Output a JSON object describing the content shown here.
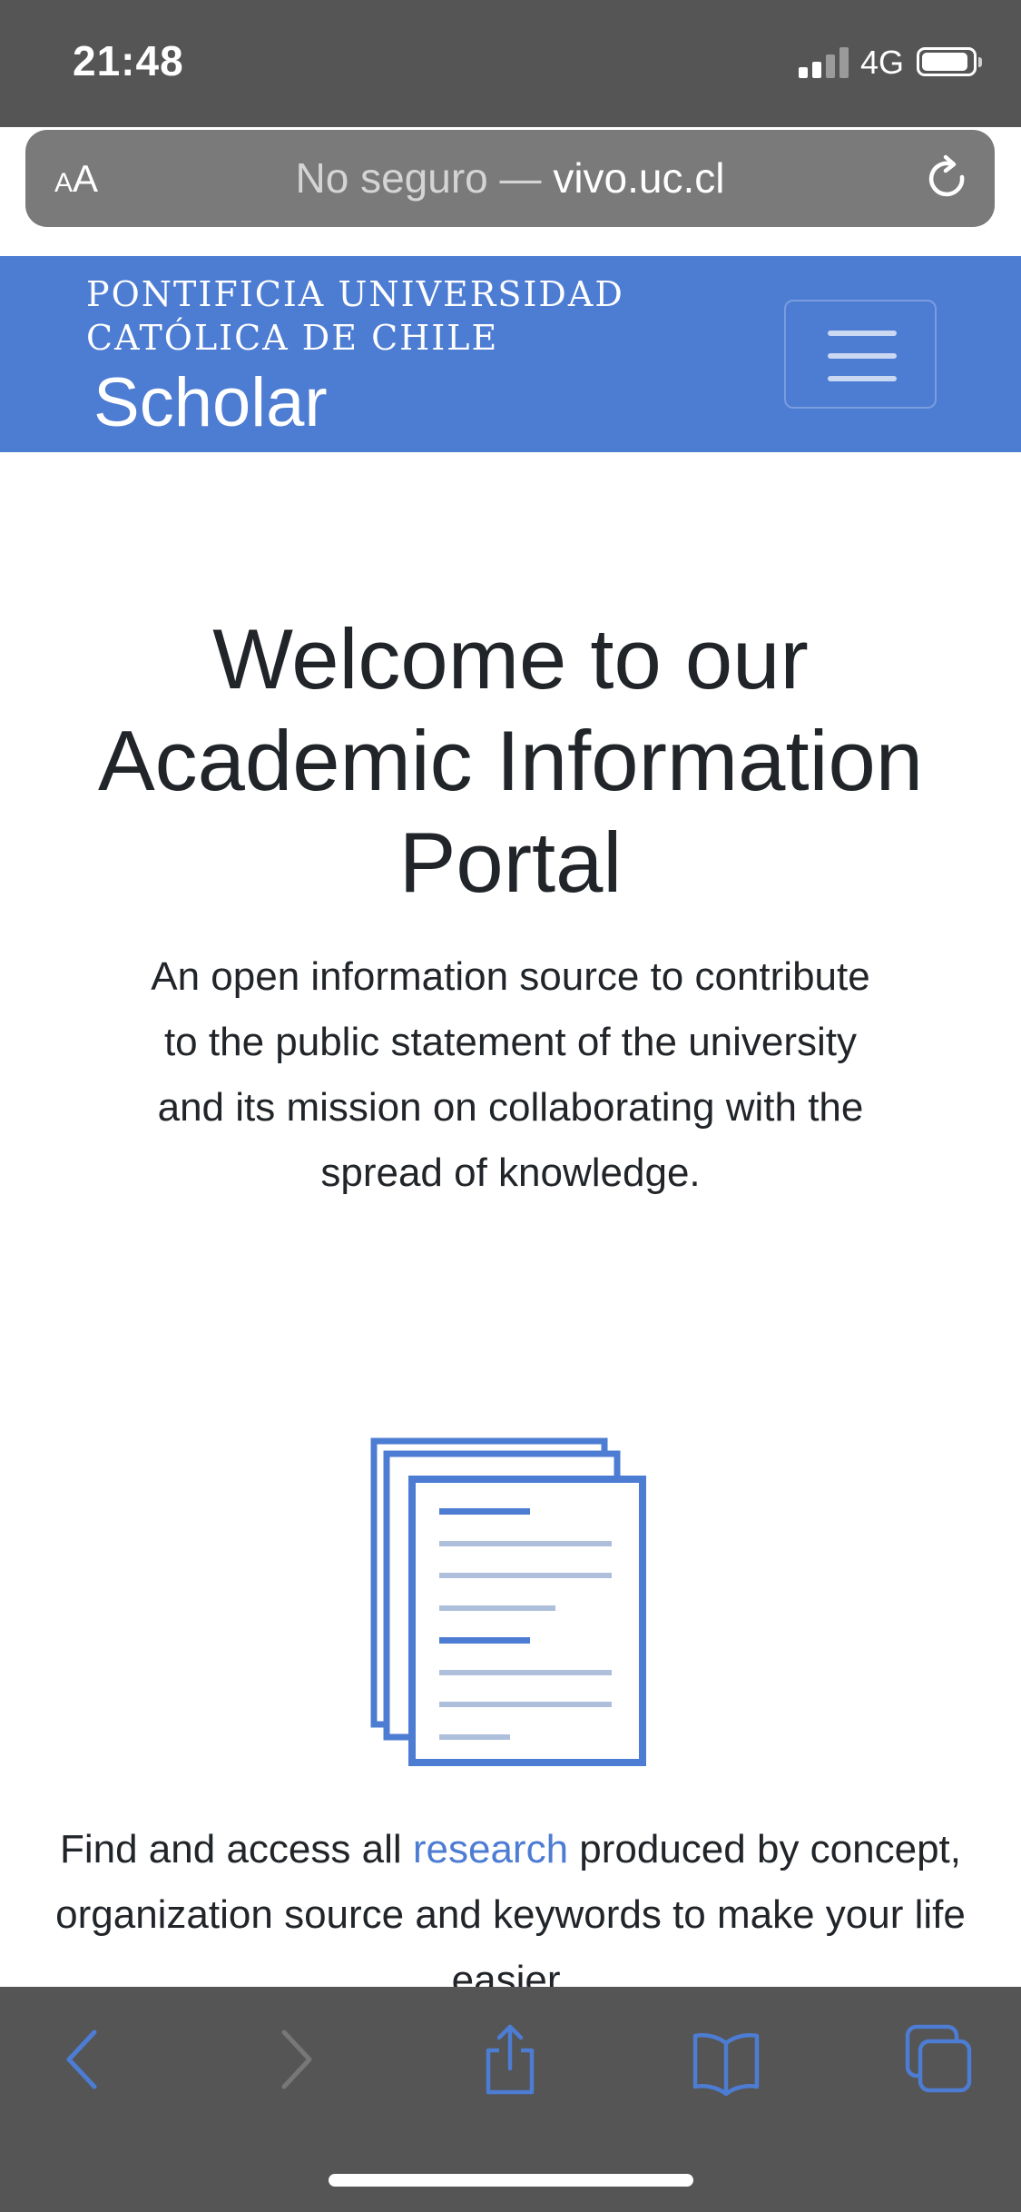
{
  "status_bar": {
    "time": "21:48",
    "network": "4G",
    "icons": [
      "signal-icon",
      "battery-icon"
    ]
  },
  "address_bar": {
    "aa_small": "A",
    "aa_large": "A",
    "url_prefix": "No seguro — ",
    "url_host": "vivo.uc.cl",
    "icon": "reload-icon"
  },
  "site_header": {
    "institution_line1": "PONTIFICIA UNIVERSIDAD",
    "institution_line2": "CATÓLICA DE CHILE",
    "brand": "Scholar",
    "menu_icon": "hamburger-menu-icon",
    "color": "#4d7cd3"
  },
  "hero": {
    "title": "Welcome to our Academic Information Portal",
    "description": "An open information source to contribute to the public statement of the university and its mission on collaborating with the spread of knowledge."
  },
  "feature": {
    "icon": "documents-icon",
    "text_before": "Find and access all ",
    "link_text": "research",
    "text_after": " produced by concept, organization source and keywords to make your life easier."
  },
  "toolbar": {
    "icons": [
      "back-icon",
      "forward-icon",
      "share-icon",
      "bookmarks-icon",
      "tabs-icon"
    ]
  },
  "colors": {
    "accent": "#4d7cd3",
    "chrome": "#555555"
  }
}
